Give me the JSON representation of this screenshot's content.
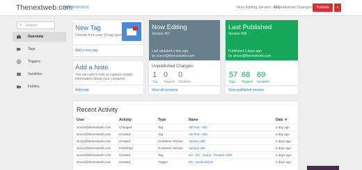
{
  "header": {
    "brand": "Thenextweb.com",
    "brand_sub": "GTM-WWGB3C",
    "now_editing_version": "Now Editing Version: 407",
    "unpublished": "Unpublished Changes: 1",
    "publish_label": "Publish",
    "publish_drop": "▾"
  },
  "sidebar": {
    "search_placeholder": "Search",
    "items": [
      {
        "label": "Overview",
        "icon": "briefcase-icon"
      },
      {
        "label": "Tags",
        "icon": "tag-icon"
      },
      {
        "label": "Triggers",
        "icon": "trigger-icon"
      },
      {
        "label": "Variables",
        "icon": "variable-icon"
      },
      {
        "label": "Folders",
        "icon": "folder-icon"
      }
    ]
  },
  "cards": {
    "new_tag": {
      "title": "New Tag",
      "desc": "Choose from over 20 tag types",
      "link": "Add a new tag"
    },
    "add_note": {
      "title": "Add a Note",
      "desc1": "You can add a note to capture certain",
      "desc2": "information about your container.",
      "link": "Add note"
    },
    "now_editing": {
      "title": "Now Editing",
      "version": "Version 407",
      "updated": "Last updated a day ago",
      "by": "by simon@thenextweb.com"
    },
    "unpublished": {
      "title": "Unpublished Changes",
      "stats": [
        {
          "num": "1",
          "label": "Tag"
        },
        {
          "num": "0",
          "label": "Triggers"
        },
        {
          "num": "0",
          "label": "Variables"
        }
      ],
      "link": "View all versions"
    },
    "last_published": {
      "title": "Last Published",
      "version": "Version 406",
      "published": "Published 2 days ago",
      "by": "by simon@thenextweb.com"
    },
    "published_stats": {
      "stats": [
        {
          "num": "57",
          "label": "Tags"
        },
        {
          "num": "68",
          "label": "Triggers"
        },
        {
          "num": "69",
          "label": "Variables"
        }
      ],
      "link": "View published version"
    }
  },
  "activity": {
    "title": "Recent Activity",
    "headers": {
      "user": "User",
      "activity": "Activity",
      "type": "Type",
      "name": "Name",
      "date": "Date ▼"
    },
    "rows": [
      {
        "user": "simon@thenextweb.com",
        "activity": "Changed",
        "type": "Tag",
        "name": "AB Test - 001",
        "date": "a day ago"
      },
      {
        "user": "simon@thenextweb.com",
        "activity": "Created",
        "type": "Tag",
        "name": "AB Test - 001",
        "date": "a day ago"
      },
      {
        "user": "simon@thenextweb.com",
        "activity": "Created",
        "type": "Container Version",
        "name": "Version 406",
        "date": "2 days ago"
      },
      {
        "user": "simon@thenextweb.com",
        "activity": "Published",
        "type": "Container Version",
        "name": "Version 406",
        "date": "2 days ago"
      },
      {
        "user": "simon@thenextweb.com",
        "activity": "Created",
        "type": "Tag",
        "name": "GA - EC - Event - Product Click",
        "date": "2 days ago"
      },
      {
        "user": "simon@thenextweb.com",
        "activity": "Created",
        "type": "Trigger",
        "name": "EC - productClick",
        "date": "2 days ago"
      }
    ]
  },
  "colors": {
    "publish": "#db2f2f",
    "now_editing": "#687f8c",
    "last_published": "#16a85a",
    "link": "#2a73c0"
  }
}
